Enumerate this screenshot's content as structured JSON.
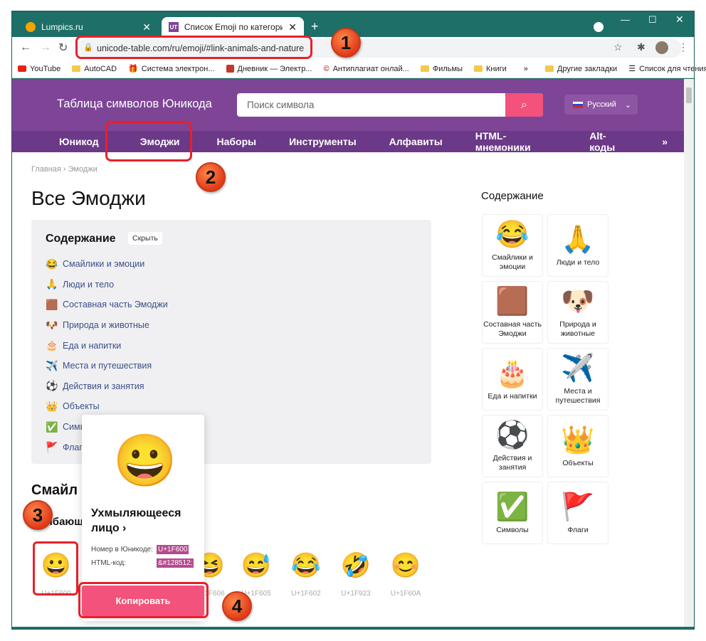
{
  "browser": {
    "tabs": [
      {
        "title": "Lumpics.ru",
        "active": false
      },
      {
        "title": "Список Emoji по категориям, в",
        "active": true
      }
    ],
    "url": "unicode-table.com/ru/emoji/#link-animals-and-nature",
    "bookmarks": [
      "YouTube",
      "AutoCAD",
      "Система электрон...",
      "Дневник — Электр...",
      "Антиплагиат онлай...",
      "Фильмы",
      "Книги",
      "»",
      "Другие закладки",
      "Список для чтения"
    ]
  },
  "site": {
    "logo": "Таблица символов Юникода",
    "search_placeholder": "Поиск символа",
    "lang": "Русский",
    "nav": [
      "Юникод",
      "Эмоджи",
      "Наборы",
      "Инструменты",
      "Алфавиты",
      "HTML-мнемоники",
      "Alt-коды",
      "»"
    ]
  },
  "breadcrumb": "Главная › Эмоджи",
  "page_title": "Все Эмоджи",
  "toc": {
    "title": "Содержание",
    "hide": "Скрыть",
    "items": [
      {
        "icon": "😂",
        "label": "Смайлики и эмоции"
      },
      {
        "icon": "🙏",
        "label": "Люди и тело"
      },
      {
        "icon": "🟫",
        "label": "Составная часть Эмоджи"
      },
      {
        "icon": "🐶",
        "label": "Природа и животные"
      },
      {
        "icon": "🎂",
        "label": "Еда и напитки"
      },
      {
        "icon": "✈️",
        "label": "Места и путешествия"
      },
      {
        "icon": "⚽",
        "label": "Действия и занятия"
      },
      {
        "icon": "👑",
        "label": "Объекты"
      },
      {
        "icon": "✅",
        "label": "Символы"
      },
      {
        "icon": "🚩",
        "label": "Флаги"
      }
    ]
  },
  "sidebar": {
    "title": "Содержание",
    "cards": [
      {
        "icon": "😂",
        "label": "Смайлики и эмоции"
      },
      {
        "icon": "🙏",
        "label": "Люди и тело"
      },
      {
        "icon": "🟫",
        "label": "Составная часть Эмоджи"
      },
      {
        "icon": "🐶",
        "label": "Природа и животные"
      },
      {
        "icon": "🎂",
        "label": "Еда и напитки"
      },
      {
        "icon": "✈️",
        "label": "Места и путешествия"
      },
      {
        "icon": "⚽",
        "label": "Действия и занятия"
      },
      {
        "icon": "👑",
        "label": "Объекты"
      },
      {
        "icon": "✅",
        "label": "Символы"
      },
      {
        "icon": "🚩",
        "label": "Флаги"
      }
    ]
  },
  "section": {
    "heading": "Смайл",
    "subheading": "ыбающ",
    "emojis": [
      {
        "icon": "😀",
        "code": "U+1F600"
      },
      {
        "icon": "😆",
        "code": "U+1F606"
      },
      {
        "icon": "😅",
        "code": "U+1F605"
      },
      {
        "icon": "😂",
        "code": "U+1F602"
      },
      {
        "icon": "🤣",
        "code": "U+1F923"
      },
      {
        "icon": "😊",
        "code": "U+1F60A"
      }
    ]
  },
  "popup": {
    "emoji": "😀",
    "name": "Ухмыляющееся лицо ›",
    "unicode_label": "Номер в Юникоде:",
    "unicode_value": "U+1F600",
    "html_label": "HTML-код:",
    "html_value": "&#128512;",
    "copy_button": "Копировать"
  },
  "annotations": [
    "1",
    "2",
    "3",
    "4"
  ],
  "colors": {
    "brand": "#7e4596",
    "nav": "#6b3987",
    "accent": "#f2527b",
    "annotation": "#e8202a"
  }
}
